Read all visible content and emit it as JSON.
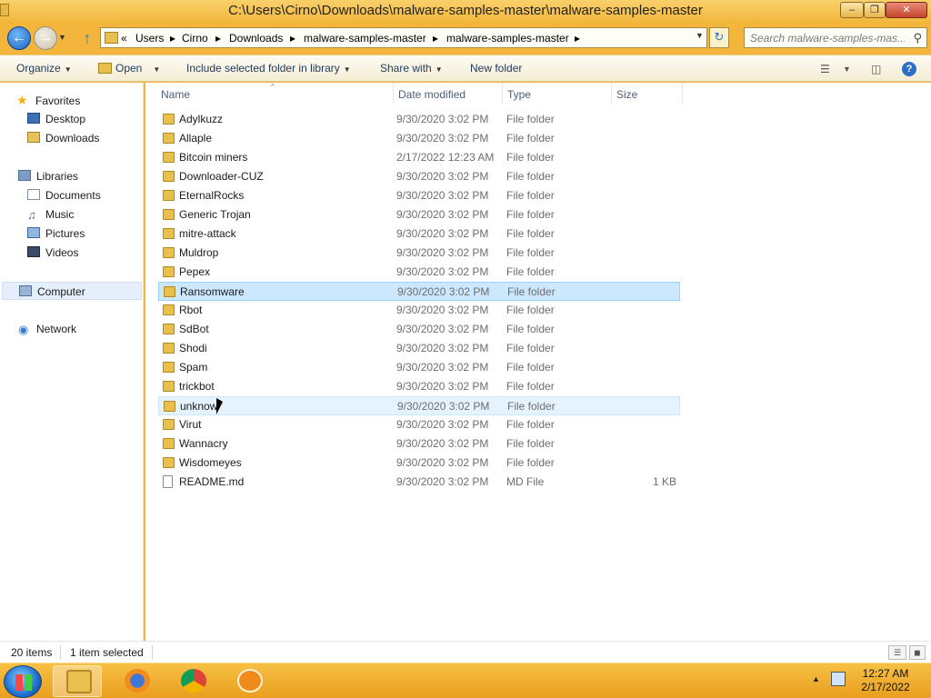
{
  "window": {
    "title": "C:\\Users\\Cirno\\Downloads\\malware-samples-master\\malware-samples-master",
    "min_glyph": "–",
    "max_glyph": "❐",
    "close_glyph": "✕"
  },
  "nav": {
    "crumbs": [
      "«",
      "Users",
      "Cirno",
      "Downloads",
      "malware-samples-master",
      "malware-samples-master"
    ],
    "separator": "▸",
    "search_placeholder": "Search malware-samples-mas..."
  },
  "toolbar": {
    "organize": "Organize",
    "open": "Open",
    "include": "Include selected folder in library",
    "share": "Share with",
    "new_folder": "New folder"
  },
  "sidebar": {
    "favorites": "Favorites",
    "desktop": "Desktop",
    "downloads": "Downloads",
    "libraries": "Libraries",
    "documents": "Documents",
    "music": "Music",
    "pictures": "Pictures",
    "videos": "Videos",
    "computer": "Computer",
    "network": "Network"
  },
  "columns": {
    "name": "Name",
    "date": "Date modified",
    "type": "Type",
    "size": "Size"
  },
  "files": [
    {
      "name": "Adylkuzz",
      "date": "9/30/2020 3:02 PM",
      "type": "File folder",
      "size": ""
    },
    {
      "name": "Allaple",
      "date": "9/30/2020 3:02 PM",
      "type": "File folder",
      "size": ""
    },
    {
      "name": "Bitcoin miners",
      "date": "2/17/2022 12:23 AM",
      "type": "File folder",
      "size": ""
    },
    {
      "name": "Downloader-CUZ",
      "date": "9/30/2020 3:02 PM",
      "type": "File folder",
      "size": ""
    },
    {
      "name": "EternalRocks",
      "date": "9/30/2020 3:02 PM",
      "type": "File folder",
      "size": ""
    },
    {
      "name": "Generic Trojan",
      "date": "9/30/2020 3:02 PM",
      "type": "File folder",
      "size": ""
    },
    {
      "name": "mitre-attack",
      "date": "9/30/2020 3:02 PM",
      "type": "File folder",
      "size": ""
    },
    {
      "name": "Muldrop",
      "date": "9/30/2020 3:02 PM",
      "type": "File folder",
      "size": ""
    },
    {
      "name": "Pepex",
      "date": "9/30/2020 3:02 PM",
      "type": "File folder",
      "size": ""
    },
    {
      "name": "Ransomware",
      "date": "9/30/2020 3:02 PM",
      "type": "File folder",
      "size": ""
    },
    {
      "name": "Rbot",
      "date": "9/30/2020 3:02 PM",
      "type": "File folder",
      "size": ""
    },
    {
      "name": "SdBot",
      "date": "9/30/2020 3:02 PM",
      "type": "File folder",
      "size": ""
    },
    {
      "name": "Shodi",
      "date": "9/30/2020 3:02 PM",
      "type": "File folder",
      "size": ""
    },
    {
      "name": "Spam",
      "date": "9/30/2020 3:02 PM",
      "type": "File folder",
      "size": ""
    },
    {
      "name": "trickbot",
      "date": "9/30/2020 3:02 PM",
      "type": "File folder",
      "size": ""
    },
    {
      "name": "unknow",
      "date": "9/30/2020 3:02 PM",
      "type": "File folder",
      "size": ""
    },
    {
      "name": "Virut",
      "date": "9/30/2020 3:02 PM",
      "type": "File folder",
      "size": ""
    },
    {
      "name": "Wannacry",
      "date": "9/30/2020 3:02 PM",
      "type": "File folder",
      "size": ""
    },
    {
      "name": "Wisdomeyes",
      "date": "9/30/2020 3:02 PM",
      "type": "File folder",
      "size": ""
    },
    {
      "name": "README.md",
      "date": "9/30/2020 3:02 PM",
      "type": "MD File",
      "size": "1 KB"
    }
  ],
  "selected_file": "Ransomware",
  "hovered_file": "unknow",
  "status": {
    "count": "20 items",
    "selected": "1 item selected"
  },
  "taskbar": {
    "apps": [
      "explorer-icon",
      "firefox-icon",
      "chrome-icon",
      "ccleaner-icon"
    ],
    "time": "12:27 AM",
    "date": "2/17/2022"
  },
  "colors": {
    "theme": "#f3b53c",
    "selection": "#cce8ff"
  }
}
